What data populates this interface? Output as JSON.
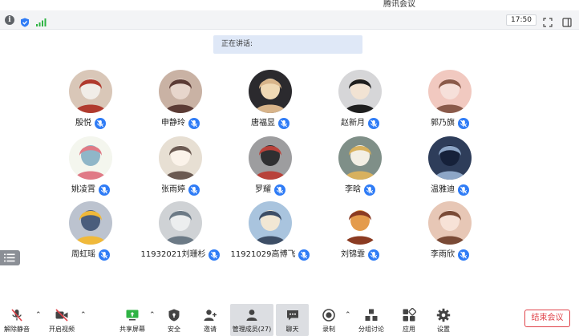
{
  "window": {
    "title": "腾讯会议"
  },
  "status": {
    "time": "17:50"
  },
  "speaking": {
    "label": "正在讲话:"
  },
  "participants": [
    {
      "name": "殷悦"
    },
    {
      "name": "申静玲"
    },
    {
      "name": "唐福昱"
    },
    {
      "name": "赵新月"
    },
    {
      "name": "郭乃旗"
    },
    {
      "name": "姚凌霄"
    },
    {
      "name": "张雨婷"
    },
    {
      "name": "罗耀"
    },
    {
      "name": "李晗"
    },
    {
      "name": "温雅迪"
    },
    {
      "name": "周虹瑶"
    },
    {
      "name": "11932021刘珊杉"
    },
    {
      "name": "11921029高博飞"
    },
    {
      "name": "刘锦霏"
    },
    {
      "name": "李雨欣"
    }
  ],
  "toolbar": {
    "unmute": "解除静音",
    "start_video": "开启视频",
    "share_screen": "共享屏幕",
    "security": "安全",
    "invite": "邀请",
    "manage_members": "管理成员(27)",
    "chat": "聊天",
    "record": "录制",
    "breakout": "分组讨论",
    "apps": "应用",
    "settings": "设置",
    "end_meeting": "结束会议"
  },
  "colors": {
    "accent": "#2f7cf6",
    "danger": "#e0434a"
  }
}
